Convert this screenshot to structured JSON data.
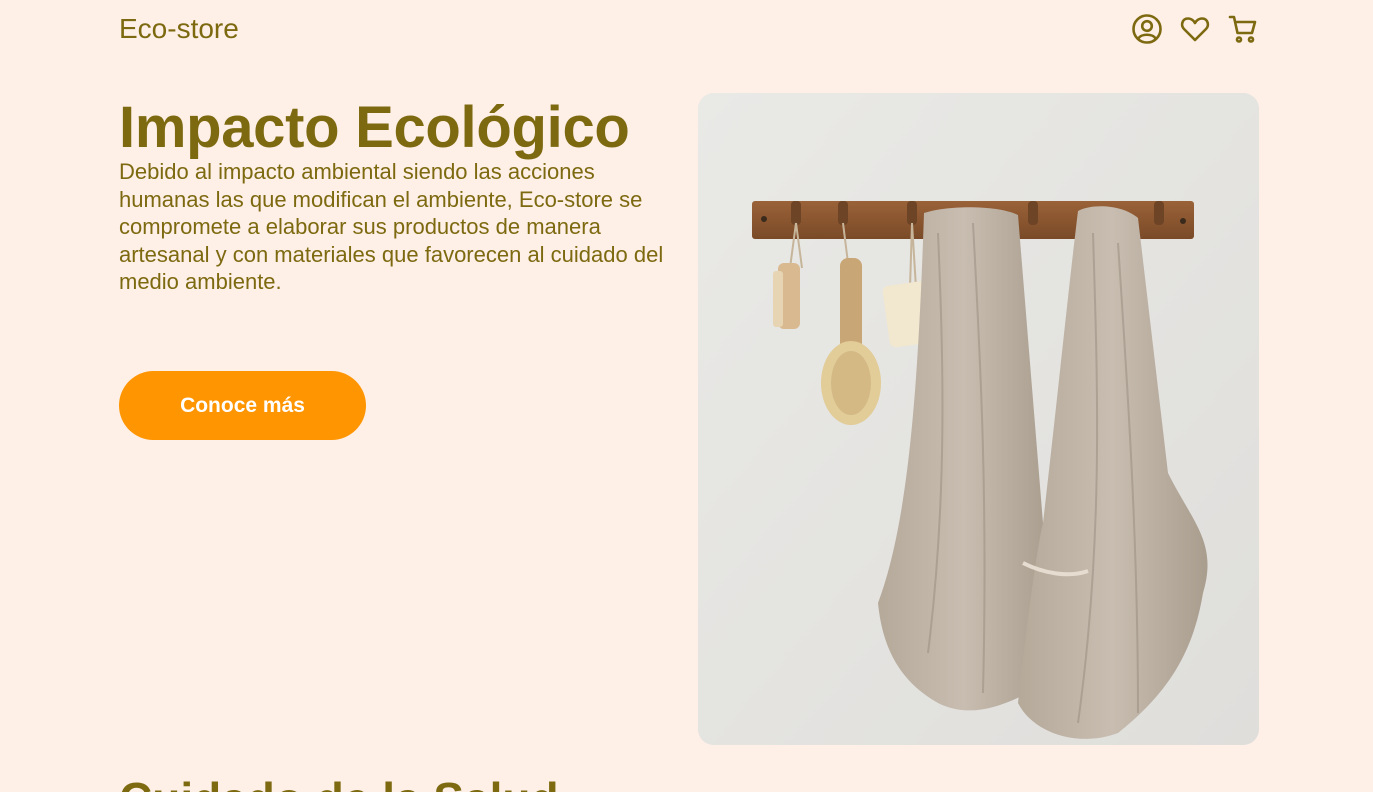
{
  "header": {
    "brand": "Eco-store",
    "icons": [
      "user-icon",
      "heart-icon",
      "cart-icon"
    ]
  },
  "hero": {
    "title": "Impacto Ecológico",
    "description": "Debido al impacto ambiental siendo las acciones humanas las que modifican el ambiente, Eco-store se compromete a elaborar sus productos de manera artesanal y con materiales que favorecen al cuidado del medio ambiente.",
    "cta_label": "Conoce más",
    "image": "towels-hanging-on-wooden-rack"
  },
  "next_section": {
    "title": "Cuidado de la Salud"
  },
  "colors": {
    "background": "#feefe7",
    "text": "#7d6a10",
    "accent": "#ff9500",
    "button_text": "#ffffff"
  }
}
